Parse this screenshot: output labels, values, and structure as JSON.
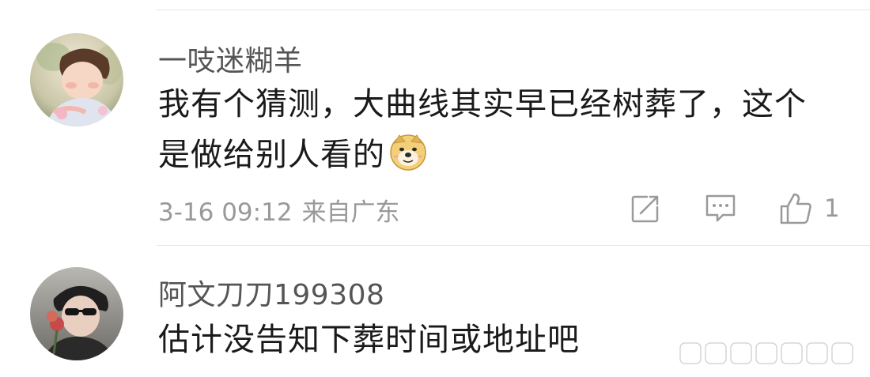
{
  "comments": [
    {
      "username": "一吱迷糊羊",
      "content_line1": "我有个猜测，大曲线其实早已经树葬了，这个",
      "content_line2": "是做给别人看的",
      "emoji_icon": "doge-emoji",
      "time": "3-16 09:12",
      "location": "来自广东",
      "like_count": "1"
    },
    {
      "username": "阿文刀刀199308",
      "content": "估计没告知下葬时间或地址吧"
    }
  ],
  "actions": {
    "share_icon": "share-icon",
    "reply_icon": "comment-icon",
    "like_icon": "thumbs-up-icon"
  },
  "colors": {
    "text_primary": "#1a1a1a",
    "text_secondary": "#999999",
    "username": "#555555",
    "divider": "#e6e6e6"
  }
}
